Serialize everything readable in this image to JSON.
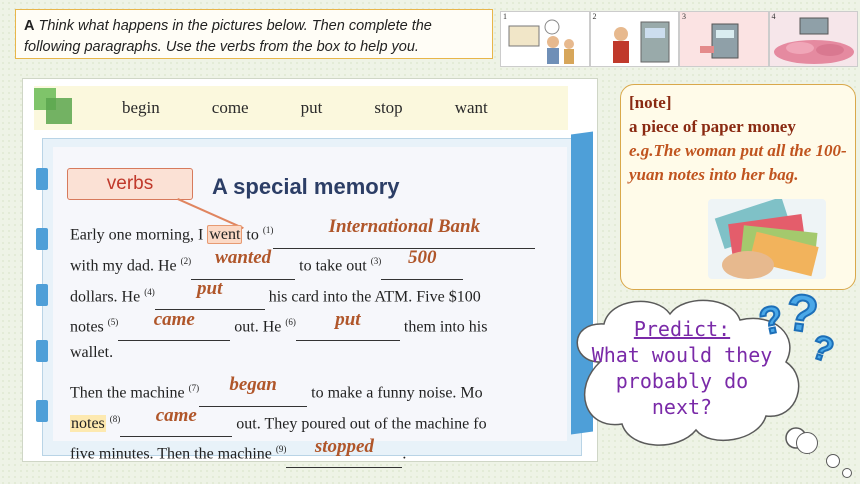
{
  "instruction": {
    "label": "A",
    "text": "Think what happens in the pictures below. Then complete the following paragraphs. Use the verbs from the box to help you."
  },
  "thumbnails": [
    {
      "num": "1"
    },
    {
      "num": "2"
    },
    {
      "num": "3"
    },
    {
      "num": "4"
    }
  ],
  "word_box": [
    "begin",
    "come",
    "put",
    "stop",
    "want"
  ],
  "verbs_label": "verbs",
  "story_title": "A special memory",
  "para1": {
    "t1": "Early one morning, I",
    "went": "went",
    "t2": "to",
    "n1": "(1)",
    "a1": "International Bank",
    "t3": "with my dad. He",
    "n2": "(2)",
    "a2": "wanted",
    "t4": "to take out",
    "n3": "(3)",
    "a3": "500",
    "t5": "dollars. He",
    "n4": "(4)",
    "a4": "put",
    "t6": "his card into the ATM. Five $100",
    "t7": "notes",
    "n5": "(5)",
    "a5": "came",
    "t8": "out. He",
    "n6": "(6)",
    "a6": "put",
    "t9": "them into his",
    "t10": "wallet."
  },
  "para2": {
    "t1": "Then the machine",
    "n7": "(7)",
    "a7": "began",
    "t2": "to make a funny noise. Mo",
    "notes": "notes",
    "n8": "(8)",
    "a8": "came",
    "t3": "out. They poured out of the machine fo",
    "t4": "five minutes. Then the machine",
    "n9": "(9)",
    "a9": "stopped",
    "t5": "."
  },
  "note": {
    "heading": "[note]",
    "definition": "a piece of paper money",
    "example": "e.g.The woman put all the 100-yuan notes into her bag."
  },
  "predict": {
    "label": "Predict:",
    "question": "What would they probably do next?"
  },
  "colors": {
    "answer": "#b0562a",
    "accent": "#4e9fd8",
    "predict": "#7a2aa8"
  }
}
